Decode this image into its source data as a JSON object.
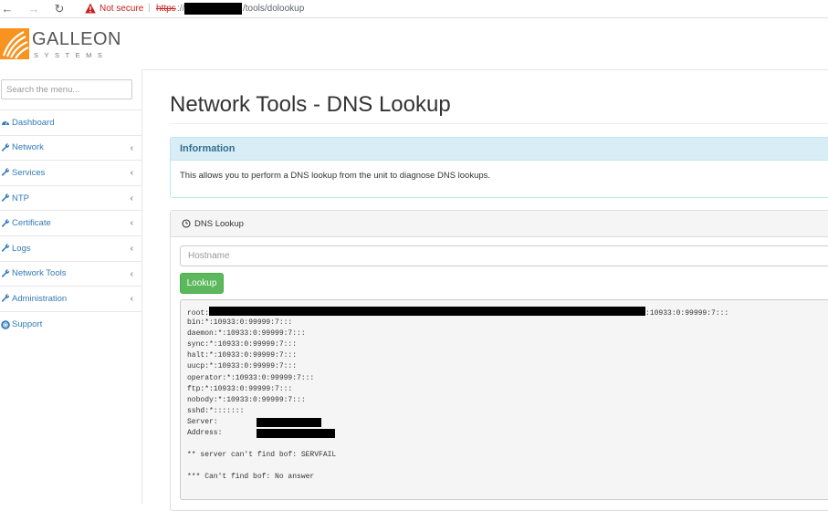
{
  "browser": {
    "back_icon": "arrow-left-icon",
    "forward_icon": "arrow-right-icon",
    "reload_icon": "reload-icon",
    "security_label": "Not secure",
    "url_protocol": "https",
    "url_slashes": "://",
    "url_path": "/tools/dolookup"
  },
  "logo": {
    "name": "GALLEON",
    "subtitle": "SYSTEMS"
  },
  "sidebar": {
    "search_placeholder": "Search the menu...",
    "items": [
      {
        "label": "Dashboard",
        "icon": "dashboard-icon",
        "expandable": false
      },
      {
        "label": "Network",
        "icon": "wrench-icon",
        "expandable": true
      },
      {
        "label": "Services",
        "icon": "wrench-icon",
        "expandable": true
      },
      {
        "label": "NTP",
        "icon": "wrench-icon",
        "expandable": true
      },
      {
        "label": "Certificate",
        "icon": "wrench-icon",
        "expandable": true
      },
      {
        "label": "Logs",
        "icon": "wrench-icon",
        "expandable": true
      },
      {
        "label": "Network Tools",
        "icon": "wrench-icon",
        "expandable": true
      },
      {
        "label": "Administration",
        "icon": "wrench-icon",
        "expandable": true
      },
      {
        "label": "Support",
        "icon": "lifebuoy-icon",
        "expandable": false
      }
    ]
  },
  "main": {
    "title": "Network Tools - DNS Lookup",
    "info": {
      "heading": "Information",
      "text": "This allows you to perform a DNS lookup from the unit to diagnose DNS lookups."
    },
    "dns": {
      "heading": "DNS Lookup",
      "hostname_placeholder": "Hostname",
      "button_label": "Lookup",
      "output": {
        "root_prefix": "root:",
        "root_suffix": ":10933:0:99999:7:::",
        "lines": [
          "bin:*:10933:0:99999:7:::",
          "daemon:*:10933:0:99999:7:::",
          "sync:*:10933:0:99999:7:::",
          "halt:*:10933:0:99999:7:::",
          "uucp:*:10933:0:99999:7:::",
          "operator:*:10933:0:99999:7:::",
          "ftp:*:10933:0:99999:7:::",
          "nobody:*:10933:0:99999:7:::",
          "sshd:*:::::::"
        ],
        "server_label": "Server:",
        "address_label": "Address:",
        "error1": "** server can't find bof: SERVFAIL",
        "error2": "*** Can't find bof: No answer"
      }
    }
  },
  "colors": {
    "link": "#337ab7",
    "info_bg": "#d9edf7",
    "info_text": "#31708f",
    "button_green": "#5cb85c",
    "not_secure_red": "#c5221f",
    "logo_orange": "#f7931e"
  }
}
